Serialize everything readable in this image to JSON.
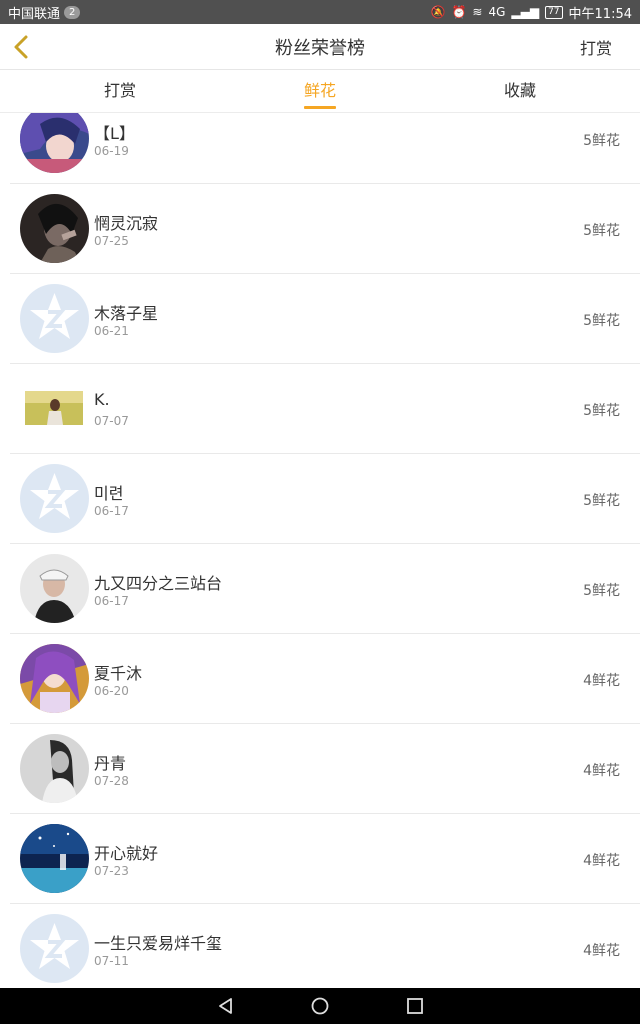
{
  "status_bar": {
    "carrier": "中国联通",
    "notification_count": "2",
    "network": "4G",
    "battery": "77",
    "time": "中午11:54"
  },
  "header": {
    "title": "粉丝荣誉榜",
    "right_action": "打赏"
  },
  "tabs": [
    {
      "label": "打赏",
      "active": false
    },
    {
      "label": "鲜花",
      "active": true
    },
    {
      "label": "收藏",
      "active": false
    }
  ],
  "fans": [
    {
      "name": "【L】",
      "date": "06-19",
      "count": "5鲜花",
      "avatar": "anime-purple"
    },
    {
      "name": "惘灵沉寂",
      "date": "07-25",
      "count": "5鲜花",
      "avatar": "dark-portrait"
    },
    {
      "name": "木落子星",
      "date": "06-21",
      "count": "5鲜花",
      "avatar": "default"
    },
    {
      "name": "K.",
      "date": "07-07",
      "count": "5鲜花",
      "avatar": "photo-square"
    },
    {
      "name": "미련",
      "date": "06-17",
      "count": "5鲜花",
      "avatar": "default"
    },
    {
      "name": "九又四分之三站台",
      "date": "06-17",
      "count": "5鲜花",
      "avatar": "man-cap"
    },
    {
      "name": "夏千沐",
      "date": "06-20",
      "count": "4鲜花",
      "avatar": "anime-girl"
    },
    {
      "name": "丹青",
      "date": "07-28",
      "count": "4鲜花",
      "avatar": "bw-girl"
    },
    {
      "name": "开心就好",
      "date": "07-23",
      "count": "4鲜花",
      "avatar": "night-sky"
    },
    {
      "name": "一生只爱易烊千玺",
      "date": "07-11",
      "count": "4鲜花",
      "avatar": "default"
    }
  ],
  "colors": {
    "accent": "#f5a623",
    "text": "#333333",
    "subtext": "#999999",
    "divider": "#e9e9e9"
  }
}
